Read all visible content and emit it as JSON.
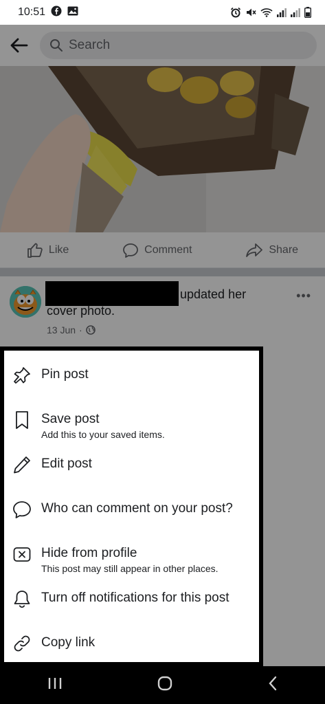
{
  "status": {
    "time": "10:51"
  },
  "search": {
    "placeholder": "Search"
  },
  "actions": [
    {
      "label": "Like"
    },
    {
      "label": "Comment"
    },
    {
      "label": "Share"
    }
  ],
  "post": {
    "line1_suffix": "updated her",
    "line2": "cover photo.",
    "date": "13 Jun",
    "separator": "·",
    "more": "•••"
  },
  "menu": [
    {
      "icon": "pin-icon",
      "label": "Pin post",
      "sub": ""
    },
    {
      "icon": "bookmark-icon",
      "label": "Save post",
      "sub": "Add this to your saved items."
    },
    {
      "icon": "pencil-icon",
      "label": "Edit post",
      "sub": ""
    },
    {
      "icon": "comment-bubble-icon",
      "label": "Who can comment on your post?",
      "sub": ""
    },
    {
      "icon": "hide-box-icon",
      "label": "Hide from profile",
      "sub": "This post may still appear in other places."
    },
    {
      "icon": "bell-icon",
      "label": "Turn off notifications for this post",
      "sub": ""
    },
    {
      "icon": "link-icon",
      "label": "Copy link",
      "sub": ""
    }
  ],
  "colors": {
    "dim": "#000000",
    "search_bg": "#eaebed",
    "muted": "#65676b"
  }
}
